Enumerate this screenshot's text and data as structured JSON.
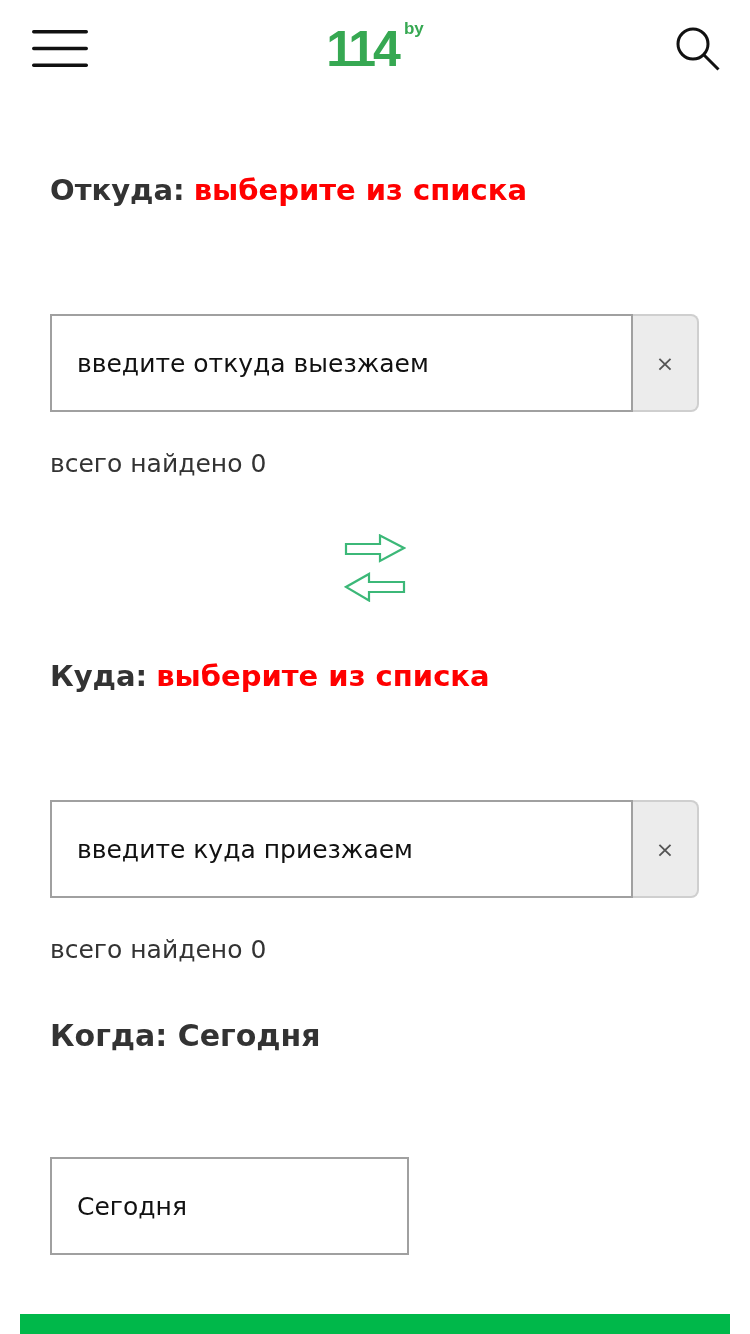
{
  "header": {
    "logo": {
      "number": "114",
      "suffix": "by"
    }
  },
  "from": {
    "label": "Откуда:",
    "status": "выберите из списка",
    "field": {
      "placeholder": "введите откуда выезжаем"
    },
    "clear": "×",
    "found": "всего найдено 0"
  },
  "to": {
    "label": "Куда:",
    "status": "выберите из списка",
    "field": {
      "placeholder": "введите куда приезжаем"
    },
    "clear": "×",
    "found": "всего найдено 0"
  },
  "when": {
    "title": "Когда: Сегодня",
    "field": {
      "value": "Сегодня"
    }
  }
}
